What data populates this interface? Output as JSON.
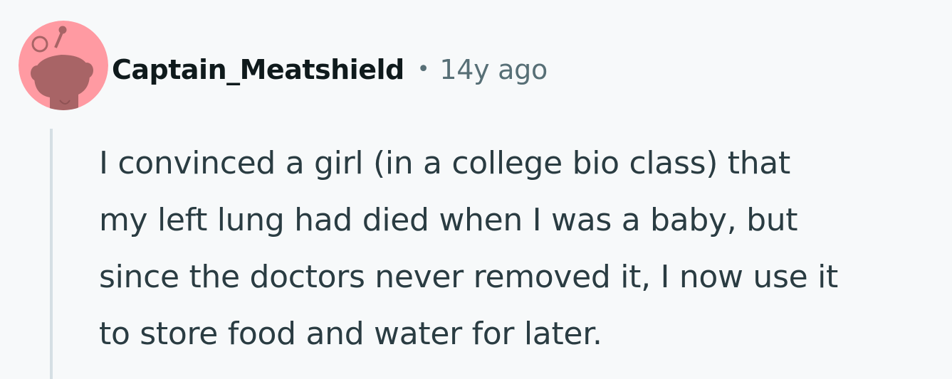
{
  "comment": {
    "author": "Captain_Meatshield",
    "separator": "•",
    "timestamp": "14y ago",
    "body_lines": [
      "I convinced a girl (in a college bio class) that",
      "my left lung had died when I was a baby, but",
      "since the doctors never removed it, I now use it",
      "to store food and water for later."
    ]
  },
  "avatar": {
    "icon": "snoo-avatar-icon",
    "background_color": "#ff9aa2",
    "figure_color": "#a86466"
  },
  "colors": {
    "page_background": "#f7f9fa",
    "author_text": "#0f1a1c",
    "meta_text": "#576f76",
    "body_text": "#2a3c42",
    "thread_line": "#d5dfe4"
  }
}
